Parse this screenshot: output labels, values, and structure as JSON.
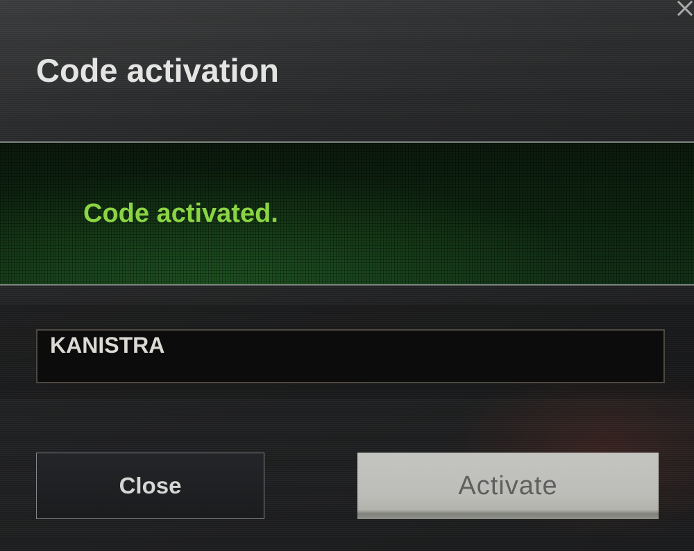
{
  "window": {
    "title": "Code activation"
  },
  "icons": {
    "close": "close-icon"
  },
  "status": {
    "message": "Code activated."
  },
  "code_field": {
    "value": "KANISTRA"
  },
  "buttons": {
    "close_label": "Close",
    "activate_label": "Activate",
    "activate_disabled": true
  },
  "colors": {
    "title_text": "#e4e4e2",
    "success_text": "#8bd444",
    "activate_disabled_bg": "#c4c4c0",
    "activate_disabled_text": "#5f5f5f"
  }
}
